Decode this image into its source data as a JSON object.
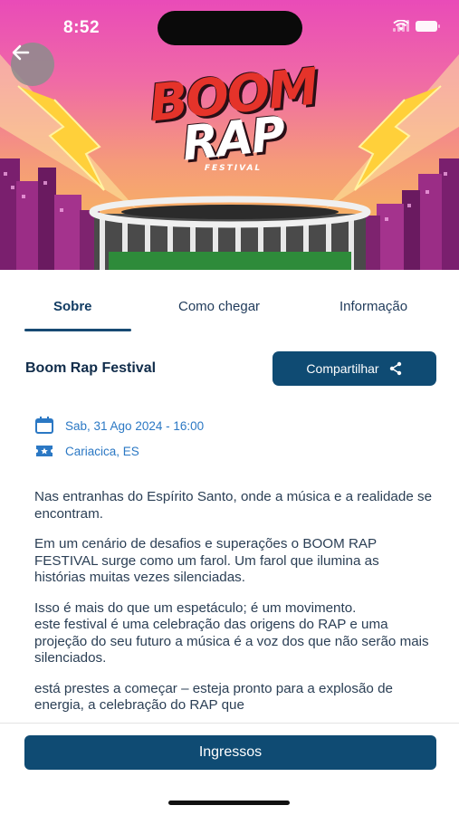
{
  "status_bar": {
    "time": "8:52"
  },
  "hero": {
    "logo_line1": "BOOM",
    "logo_line2": "RAP",
    "logo_subtitle": "FESTIVAL",
    "back_icon": "arrow-left-icon"
  },
  "tabs": [
    {
      "label": "Sobre",
      "active": true
    },
    {
      "label": "Como chegar",
      "active": false
    },
    {
      "label": "Informação",
      "active": false
    }
  ],
  "event": {
    "title": "Boom Rap Festival",
    "share_label": "Compartilhar",
    "date": "Sab, 31 Ago 2024 - 16:00",
    "location": "Cariacica, ES"
  },
  "description": [
    "Nas entranhas do Espírito Santo, onde a música e a realidade se encontram.",
    "Em um cenário de desafios e superações o BOOM RAP FESTIVAL surge como um farol. Um farol que ilumina as histórias muitas vezes silenciadas.",
    "Isso é mais do que um espetáculo; é um movimento.\neste festival é uma celebração das origens do RAP e uma projeção do seu futuro a música é a voz dos que não serão mais silenciados.",
    "está prestes a começar – esteja pronto para a explosão de energia, a celebração do RAP que"
  ],
  "footer": {
    "button_label": "Ingressos"
  },
  "colors": {
    "primary": "#0f4b73",
    "accent_text": "#2b78c4",
    "title": "#102c4a"
  }
}
